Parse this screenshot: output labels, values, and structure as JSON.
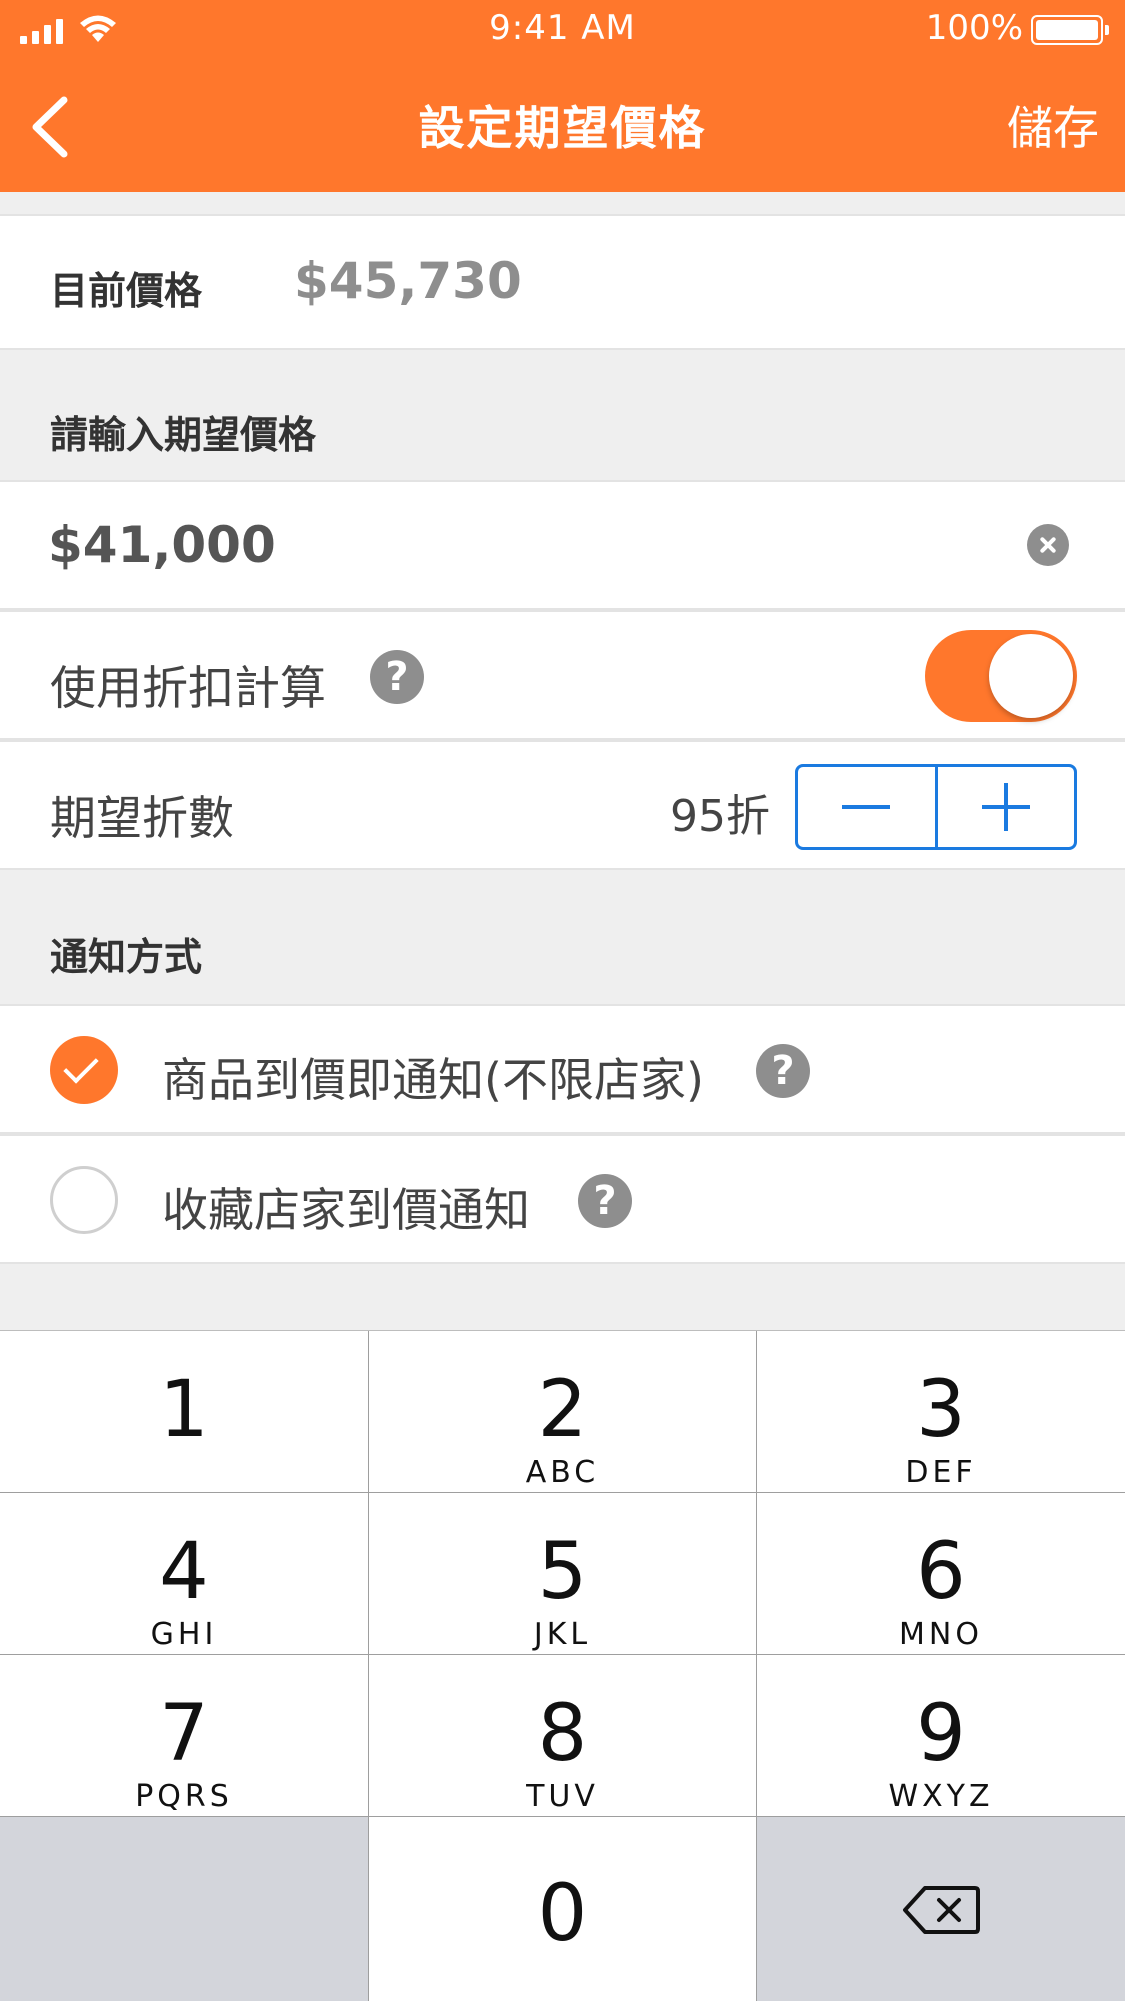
{
  "status_bar": {
    "time": "9:41 AM",
    "battery": "100%",
    "battery_level": 1.0
  },
  "nav": {
    "back_icon": "chevron-left-icon",
    "title": "設定期望價格",
    "save_label": "儲存"
  },
  "current_price": {
    "label": "目前價格",
    "value": "$45,730"
  },
  "expected_price": {
    "section_label": "請輸入期望價格",
    "value": "$41,000",
    "clear_icon": "clear-circle-icon"
  },
  "discount_toggle": {
    "label": "使用折扣計算",
    "help": "?",
    "on": true
  },
  "discount": {
    "label": "期望折數",
    "value": "95折"
  },
  "notify": {
    "section_label": "通知方式",
    "options": [
      {
        "label": "商品到價即通知(不限店家)",
        "checked": true,
        "help": "?"
      },
      {
        "label": "收藏店家到價通知",
        "checked": false,
        "help": "?"
      }
    ]
  },
  "keypad": {
    "keys": [
      {
        "num": "1",
        "letters": ""
      },
      {
        "num": "2",
        "letters": "ABC"
      },
      {
        "num": "3",
        "letters": "DEF"
      },
      {
        "num": "4",
        "letters": "GHI"
      },
      {
        "num": "5",
        "letters": "JKL"
      },
      {
        "num": "6",
        "letters": "MNO"
      },
      {
        "num": "7",
        "letters": "PQRS"
      },
      {
        "num": "8",
        "letters": "TUV"
      },
      {
        "num": "9",
        "letters": "WXYZ"
      },
      {
        "num": "0",
        "letters": ""
      }
    ],
    "backspace_icon": "backspace-icon"
  },
  "colors": {
    "accent": "#ff772c",
    "stepper_blue": "#1a7ae0",
    "background": "#efefef"
  }
}
